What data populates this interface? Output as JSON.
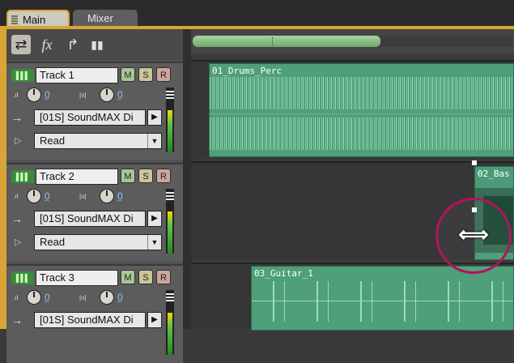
{
  "tabs": [
    {
      "label": "Main",
      "active": true
    },
    {
      "label": "Mixer",
      "active": false
    }
  ],
  "toolbar": {
    "icons": [
      "switch-view-icon",
      "fx-icon",
      "sends-icon",
      "meter-icon"
    ],
    "fx_label": "fx"
  },
  "tracks": [
    {
      "name": "Track 1",
      "m": "M",
      "s": "S",
      "r": "R",
      "volume": "0",
      "pan": "0",
      "input": "[01S] SoundMAX Di",
      "automation": "Read"
    },
    {
      "name": "Track 2",
      "m": "M",
      "s": "S",
      "r": "R",
      "volume": "0",
      "pan": "0",
      "input": "[01S] SoundMAX Di",
      "automation": "Read"
    },
    {
      "name": "Track 3",
      "m": "M",
      "s": "S",
      "r": "R",
      "volume": "0",
      "pan": "0",
      "input": "[01S] SoundMAX Di"
    }
  ],
  "clips": [
    {
      "name": "01_Drums_Perc"
    },
    {
      "name": "02_Bas"
    },
    {
      "name": "03_Guitar_1"
    }
  ],
  "colors": {
    "accent": "#d9a436",
    "clip": "#4f9f7a",
    "highlight_circle": "#b0155a"
  }
}
